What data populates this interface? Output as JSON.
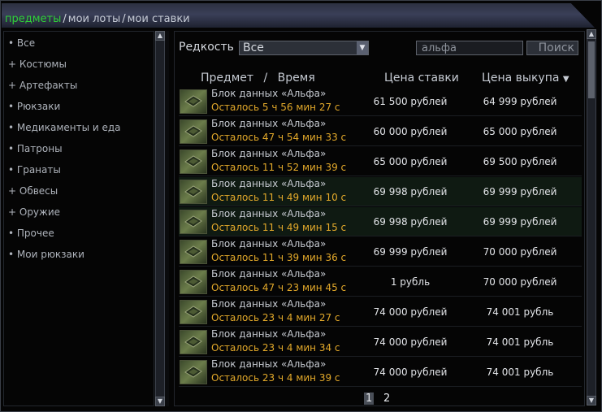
{
  "tabs": {
    "items": [
      "предметы",
      "мои лоты",
      "мои ставки"
    ],
    "separator": "/"
  },
  "categories": [
    "• Все",
    "+ Костюмы",
    "+ Артефакты",
    "• Рюкзаки",
    "• Медикаменты и еда",
    "• Патроны",
    "• Гранаты",
    "+ Обвесы",
    "+ Оружие",
    "• Прочее",
    "• Мои рюкзаки"
  ],
  "filter": {
    "rarity_label": "Редкость",
    "rarity_value": "Все",
    "search_value": "альфа",
    "search_button": "Поиск"
  },
  "columns": {
    "item": "Предмет",
    "slash": "/",
    "time": "Время",
    "bid": "Цена ставки",
    "buyout": "Цена выкупа",
    "sort_icon": "▼"
  },
  "rows": [
    {
      "name": "Блок данных «Альфа»",
      "time": "Осталось 5 ч 56 мин 27 с",
      "bid": "61 500 рублей",
      "buyout": "64 999 рублей",
      "highlight": false
    },
    {
      "name": "Блок данных «Альфа»",
      "time": "Осталось 47 ч 54 мин 33 с",
      "bid": "60 000 рублей",
      "buyout": "65 000 рублей",
      "highlight": false
    },
    {
      "name": "Блок данных «Альфа»",
      "time": "Осталось 11 ч 52 мин 39 с",
      "bid": "65 000 рублей",
      "buyout": "69 500 рублей",
      "highlight": false
    },
    {
      "name": "Блок данных «Альфа»",
      "time": "Осталось 11 ч 49 мин 10 с",
      "bid": "69 998 рублей",
      "buyout": "69 999 рублей",
      "highlight": true
    },
    {
      "name": "Блок данных «Альфа»",
      "time": "Осталось 11 ч 49 мин 15 с",
      "bid": "69 998 рублей",
      "buyout": "69 999 рублей",
      "highlight": true
    },
    {
      "name": "Блок данных «Альфа»",
      "time": "Осталось 11 ч 39 мин 36 с",
      "bid": "69 999 рублей",
      "buyout": "70 000 рублей",
      "highlight": false
    },
    {
      "name": "Блок данных «Альфа»",
      "time": "Осталось 47 ч 23 мин 45 с",
      "bid": "1 рубль",
      "buyout": "70 000 рублей",
      "highlight": false
    },
    {
      "name": "Блок данных «Альфа»",
      "time": "Осталось 23 ч 4 мин 27 с",
      "bid": "74 000 рублей",
      "buyout": "74 001 рубль",
      "highlight": false
    },
    {
      "name": "Блок данных «Альфа»",
      "time": "Осталось 23 ч 4 мин 34 с",
      "bid": "74 000 рублей",
      "buyout": "74 001 рубль",
      "highlight": false
    },
    {
      "name": "Блок данных «Альфа»",
      "time": "Осталось 23 ч 4 мин 39 с",
      "bid": "74 000 рублей",
      "buyout": "74 001 рубль",
      "highlight": false
    }
  ],
  "pagination": {
    "current": "1",
    "next": "2"
  },
  "colors": {
    "active_tab": "#2fd038",
    "time_text": "#e3a92a",
    "highlight_row": "#0f1a12"
  }
}
